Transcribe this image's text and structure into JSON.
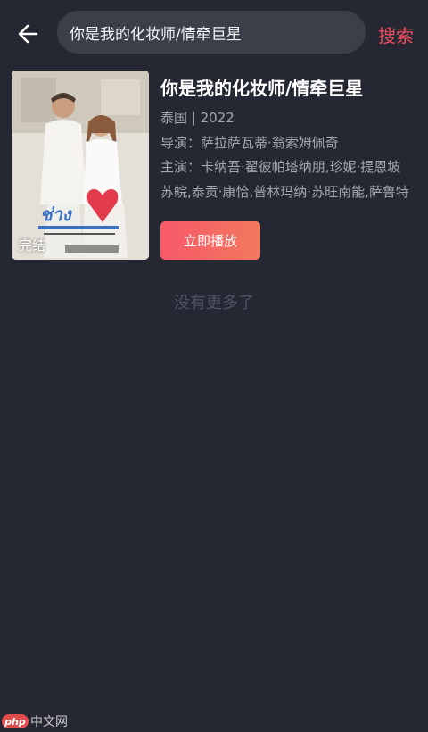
{
  "header": {
    "back_icon": "arrow-left-icon",
    "search_value": "你是我的化妆师/情牵巨星",
    "search_label": "搜索"
  },
  "result": {
    "title": "你是我的化妆师/情牵巨星",
    "meta": "泰国 | 2022",
    "director": "导演：萨拉萨瓦蒂·翁索姆佩奇",
    "cast_line1": "主演：卡纳吾·翟彼帕塔纳朋,珍妮·提恩坡",
    "cast_line2": "苏皖,泰贡·康恰,普林玛纳·苏旺南能,萨鲁特",
    "status": "完结",
    "play_label": "立即播放"
  },
  "list_end": "没有更多了",
  "watermark": {
    "logo": "php",
    "text": "中文网"
  },
  "colors": {
    "background": "#252832",
    "accent": "#f24b5e",
    "search_bg": "#3b3f4a"
  }
}
